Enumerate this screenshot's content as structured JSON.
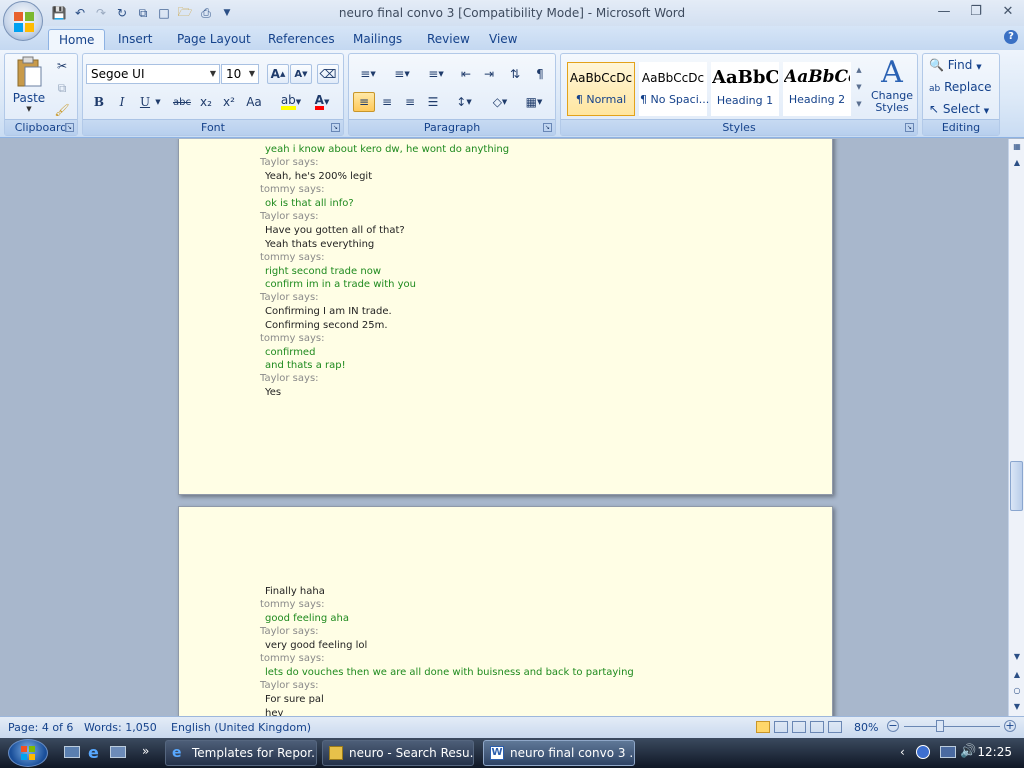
{
  "window": {
    "title": "neuro final convo 3 [Compatibility Mode] - Microsoft Word"
  },
  "quick_access": {
    "items": [
      "save-icon",
      "undo-icon",
      "redo-icon",
      "repeat-icon",
      "copy-icon",
      "new-icon",
      "open-icon",
      "print-icon",
      "customize-icon"
    ]
  },
  "tabs": [
    "Home",
    "Insert",
    "Page Layout",
    "References",
    "Mailings",
    "Review",
    "View"
  ],
  "ribbon": {
    "clipboard": {
      "label": "Clipboard",
      "paste": "Paste"
    },
    "font": {
      "label": "Font",
      "name": "Segoe UI",
      "size": "10",
      "bold": "B",
      "italic": "I",
      "underline": "U",
      "strike": "abc",
      "subscript": "x₂",
      "superscript": "x²",
      "case": "Aa",
      "grow": "A",
      "shrink": "A"
    },
    "paragraph": {
      "label": "Paragraph"
    },
    "styles": {
      "label": "Styles",
      "items": [
        {
          "sample": "AaBbCcDc",
          "name": "¶ Normal"
        },
        {
          "sample": "AaBbCcDc",
          "name": "¶ No Spaci..."
        },
        {
          "sample": "AaBbC",
          "name": "Heading 1"
        },
        {
          "sample": "AaBbCc",
          "name": "Heading 2"
        }
      ],
      "change": "Change Styles"
    },
    "editing": {
      "label": "Editing",
      "find": "Find",
      "replace": "Replace",
      "select": "Select"
    }
  },
  "page1": {
    "lines": [
      {
        "who": "tom",
        "text": "yeah i know about kero dw, he wont do anything"
      },
      {
        "who": "says",
        "text": "Taylor says:"
      },
      {
        "who": "tay",
        "text": "Yeah, he's 200% legit"
      },
      {
        "who": "says",
        "text": "tommy says:"
      },
      {
        "who": "tom",
        "text": "ok is that all info?"
      },
      {
        "who": "says",
        "text": "Taylor says:"
      },
      {
        "who": "tay",
        "text": "Have you gotten all of that?"
      },
      {
        "who": "tay",
        "text": "Yeah thats everything"
      },
      {
        "who": "says",
        "text": "tommy says:"
      },
      {
        "who": "tom",
        "text": "right second trade now"
      },
      {
        "who": "tom",
        "text": "confirm im in a trade with you"
      },
      {
        "who": "says",
        "text": "Taylor says:"
      },
      {
        "who": "tay",
        "text": "Confirming I am IN trade."
      },
      {
        "who": "tay",
        "text": "Confirming second 25m."
      },
      {
        "who": "says",
        "text": "tommy says:"
      },
      {
        "who": "tom",
        "text": "confirmed"
      },
      {
        "who": "tom",
        "text": "and thats a rap!"
      },
      {
        "who": "says",
        "text": "Taylor says:"
      },
      {
        "who": "tay",
        "text": "Yes"
      }
    ]
  },
  "page2": {
    "lines": [
      {
        "who": "tay",
        "text": "Finally haha"
      },
      {
        "who": "says",
        "text": "tommy says:"
      },
      {
        "who": "tom",
        "text": "good feeling aha"
      },
      {
        "who": "says",
        "text": "Taylor says:"
      },
      {
        "who": "tay",
        "text": "very good feeling lol"
      },
      {
        "who": "says",
        "text": "tommy says:"
      },
      {
        "who": "tom",
        "text": "lets do vouches then we are all done with buisness and back to partaying"
      },
      {
        "who": "says",
        "text": "Taylor says:"
      },
      {
        "who": "tay",
        "text": "For sure pal"
      },
      {
        "who": "tay",
        "text": "hey"
      }
    ]
  },
  "status": {
    "page": "Page: 4 of 6",
    "words": "Words: 1,050",
    "language": "English (United Kingdom)",
    "zoom": "80%"
  },
  "taskbar": {
    "items": [
      {
        "label": "Templates for Repor...",
        "active": false
      },
      {
        "label": "neuro - Search Resu...",
        "active": false
      },
      {
        "label": "neuro final convo 3 ...",
        "active": true
      }
    ],
    "clock": "12:25"
  }
}
